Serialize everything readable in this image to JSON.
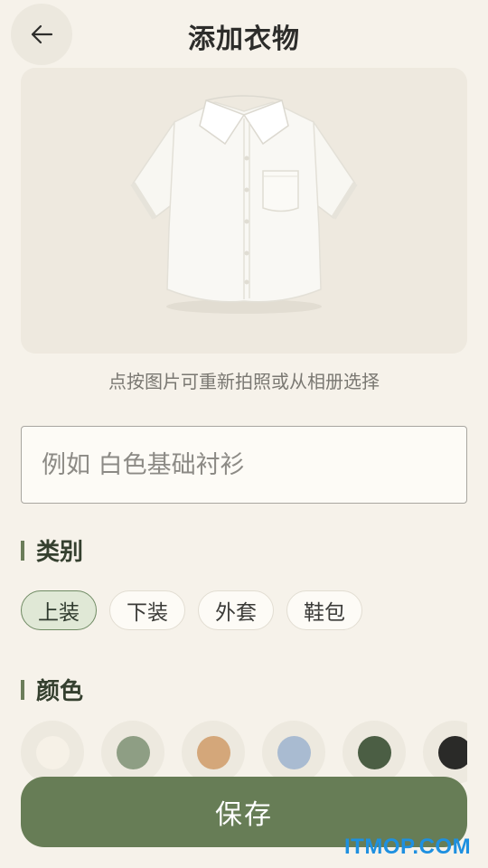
{
  "header": {
    "title": "添加衣物",
    "back_icon": "arrow-left-icon"
  },
  "photo": {
    "hint": "点按图片可重新拍照或从相册选择"
  },
  "name_field": {
    "placeholder": "例如 白色基础衬衫",
    "value": ""
  },
  "category": {
    "title": "类别",
    "options": [
      "上装",
      "下装",
      "外套",
      "鞋包"
    ],
    "selected": "上装"
  },
  "color": {
    "title": "颜色",
    "swatches": [
      "#f6f1e7",
      "#8e9e84",
      "#d4a77a",
      "#a9bbd1",
      "#4b5e44",
      "#2a2a28"
    ]
  },
  "save_button": {
    "label": "保存"
  },
  "watermark": {
    "text": "ITMOP.COM"
  },
  "theme": {
    "accent": "#677d56",
    "background": "#f6f2ea"
  }
}
